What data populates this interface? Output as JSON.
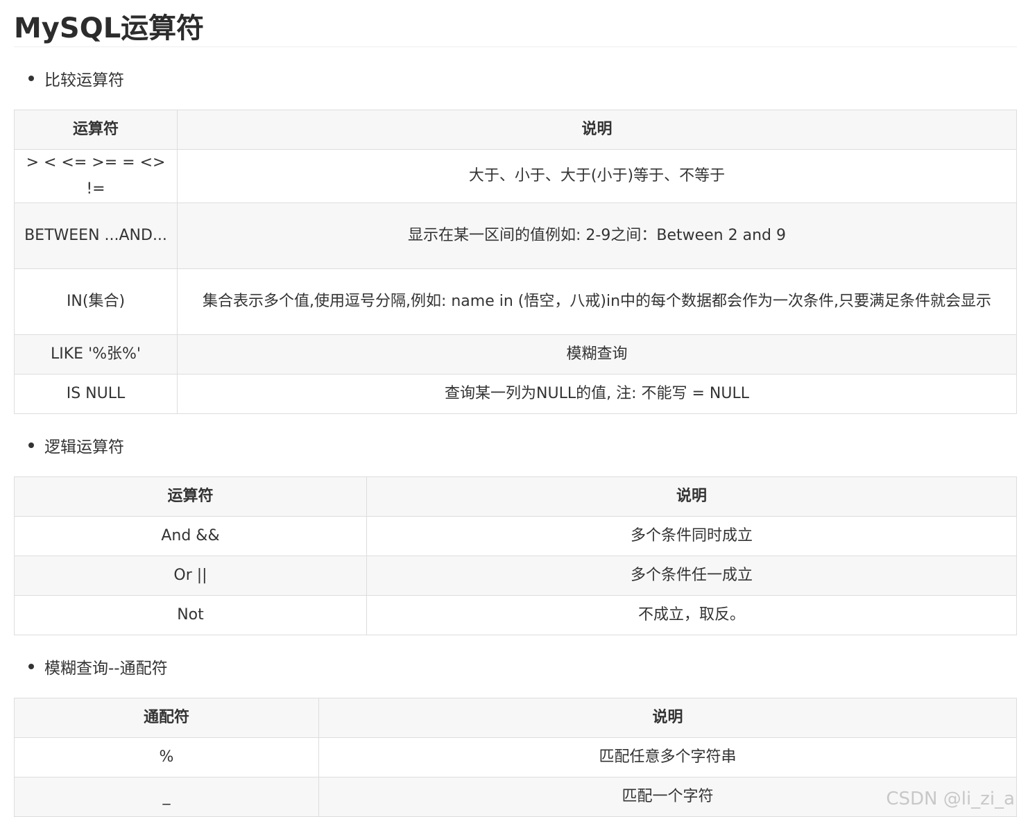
{
  "page_title": "MySQL运算符",
  "sections": [
    {
      "heading": "比较运算符",
      "columns": [
        "运算符",
        "说明"
      ],
      "rows": [
        [
          "> < <= >= = <> !=",
          "大于、小于、大于(小于)等于、不等于"
        ],
        [
          "BETWEEN ...AND...",
          "显示在某一区间的值例如: 2-9之间：Between 2 and 9"
        ],
        [
          "IN(集合)",
          "集合表示多个值,使用逗号分隔,例如: name in (悟空，八戒)in中的每个数据都会作为一次条件,只要满足条件就会显示"
        ],
        [
          "LIKE '%张%'",
          "模糊查询"
        ],
        [
          "IS NULL",
          "查询某一列为NULL的值, 注: 不能写 = NULL"
        ]
      ]
    },
    {
      "heading": "逻辑运算符",
      "columns": [
        "运算符",
        "说明"
      ],
      "rows": [
        [
          "And &&",
          "多个条件同时成立"
        ],
        [
          "Or ||",
          "多个条件任一成立"
        ],
        [
          "Not",
          "不成立，取反。"
        ]
      ]
    },
    {
      "heading": "模糊查询--通配符",
      "columns": [
        "通配符",
        "说明"
      ],
      "rows": [
        [
          "%",
          "匹配任意多个字符串"
        ],
        [
          "_",
          "匹配一个字符"
        ]
      ]
    }
  ],
  "watermark": "CSDN @li_zi_a"
}
